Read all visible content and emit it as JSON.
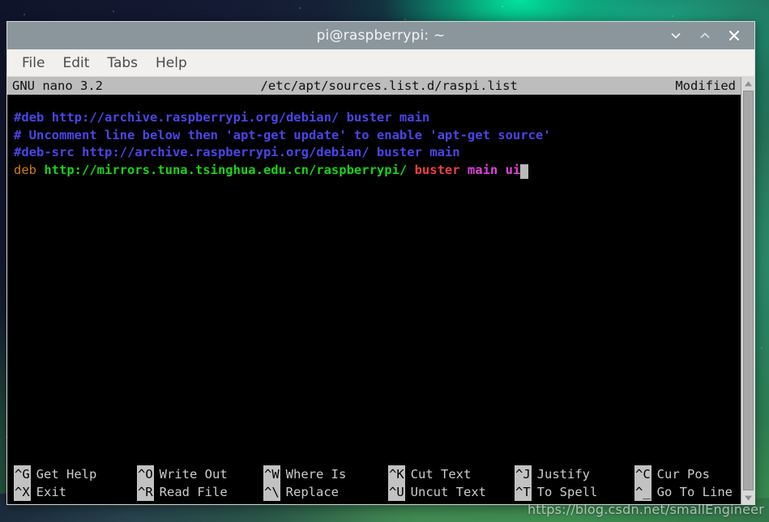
{
  "desktop": {
    "watermark": "https://blog.csdn.net/smallEngineer"
  },
  "window": {
    "title": "pi@raspberrypi: ~",
    "buttons": [
      {
        "name": "minimize-button",
        "icon": "chevron-down-icon"
      },
      {
        "name": "maximize-button",
        "icon": "chevron-up-icon"
      },
      {
        "name": "close-button",
        "icon": "close-icon"
      }
    ]
  },
  "menubar": {
    "items": [
      {
        "label": "File"
      },
      {
        "label": "Edit"
      },
      {
        "label": "Tabs"
      },
      {
        "label": "Help"
      }
    ]
  },
  "nano": {
    "status": {
      "version": "GNU nano 3.2",
      "filename": "/etc/apt/sources.list.d/raspi.list",
      "state": "Modified"
    },
    "lines": [
      {
        "segments": [
          {
            "text": "#deb http://archive.raspberrypi.org/debian/ buster main",
            "color": "blue"
          }
        ]
      },
      {
        "segments": [
          {
            "text": "# Uncomment line below then 'apt-get update' to enable 'apt-get source'",
            "color": "blue"
          }
        ]
      },
      {
        "segments": [
          {
            "text": "#deb-src http://archive.raspberrypi.org/debian/ buster main",
            "color": "blue"
          }
        ]
      },
      {
        "segments": [
          {
            "text": "deb ",
            "color": "orange"
          },
          {
            "text": "http://mirrors.tuna.tsinghua.edu.cn/raspberrypi/ ",
            "color": "green"
          },
          {
            "text": "buster ",
            "color": "red"
          },
          {
            "text": "main ui",
            "color": "magenta"
          },
          {
            "text": " ",
            "color": "cursor"
          }
        ]
      }
    ],
    "shortcuts": [
      [
        {
          "key": "^G",
          "label": "Get Help"
        },
        {
          "key": "^O",
          "label": "Write Out"
        },
        {
          "key": "^W",
          "label": "Where Is"
        },
        {
          "key": "^K",
          "label": "Cut Text"
        },
        {
          "key": "^J",
          "label": "Justify"
        },
        {
          "key": "^C",
          "label": "Cur Pos"
        }
      ],
      [
        {
          "key": "^X",
          "label": "Exit"
        },
        {
          "key": "^R",
          "label": "Read File"
        },
        {
          "key": "^\\",
          "label": "Replace"
        },
        {
          "key": "^U",
          "label": "Uncut Text"
        },
        {
          "key": "^T",
          "label": "To Spell"
        },
        {
          "key": "^_",
          "label": "Go To Line"
        }
      ]
    ]
  },
  "scrollbar": {
    "up_icon": "triangle-up-icon",
    "down_icon": "triangle-down-icon"
  },
  "colors": {
    "titlebar": "#8b969c",
    "menubar": "#f1f0ee",
    "terminal_bg": "#000000",
    "nano_status_bg": "#bdbdbd",
    "comment_blue": "#4a46e8",
    "url_green": "#19d219",
    "keyword_orange": "#cc7a10",
    "suite_red": "#f04040",
    "component_magenta": "#e040e0"
  }
}
